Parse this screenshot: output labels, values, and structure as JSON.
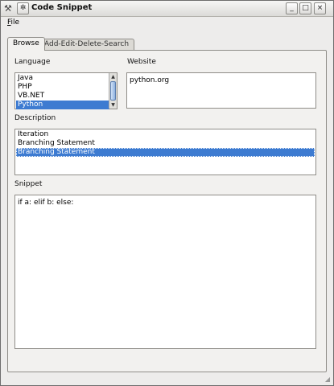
{
  "window": {
    "title": "Code Snippet",
    "controls": {
      "minimize": "_",
      "maximize": "□",
      "close": "×"
    }
  },
  "menubar": {
    "file": {
      "mnemonic": "F",
      "rest": "ile"
    }
  },
  "tabs": [
    {
      "label": "Browse",
      "active": true
    },
    {
      "label": "Add-Edit-Delete-Search",
      "active": false
    }
  ],
  "browse": {
    "language_label": "Language",
    "languages": [
      "Java",
      "PHP",
      "VB.NET",
      "Python"
    ],
    "selected_language": "Python",
    "website_label": "Website",
    "website_value": "python.org",
    "description_label": "Description",
    "descriptions": [
      "Iteration",
      "Branching Statement",
      "Branching Statement"
    ],
    "snippet_label": "Snippet",
    "snippet_value": "if a: elif b: else:"
  },
  "colors": {
    "selection": "#3d7bd1",
    "window_bg": "#edeceb"
  }
}
